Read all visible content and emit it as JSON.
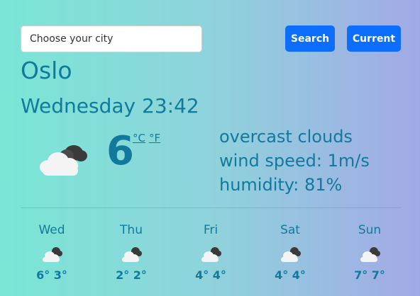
{
  "search": {
    "placeholder": "Choose your city",
    "search_label": "Search",
    "current_label": "Current"
  },
  "weather": {
    "city": "Oslo",
    "datetime": "Wednesday 23:42",
    "temperature": "6",
    "unit_c": "°C",
    "unit_f": "°F",
    "description": "overcast clouds",
    "wind": "wind speed: 1m/s",
    "humidity": "humidity: 81%",
    "icon": "overcast-cloud-icon"
  },
  "forecast": [
    {
      "day": "Wed",
      "temps": "6° 3°",
      "icon": "overcast-cloud-icon"
    },
    {
      "day": "Thu",
      "temps": "2° 2°",
      "icon": "overcast-cloud-icon"
    },
    {
      "day": "Fri",
      "temps": "4° 4°",
      "icon": "overcast-cloud-icon"
    },
    {
      "day": "Sat",
      "temps": "4° 4°",
      "icon": "overcast-cloud-icon"
    },
    {
      "day": "Sun",
      "temps": "7° 7°",
      "icon": "overcast-cloud-icon"
    }
  ],
  "colors": {
    "accent": "#117a9c",
    "button": "#0d6efd",
    "gradient_start": "#7ae6d6",
    "gradient_end": "#a3a9e6"
  }
}
